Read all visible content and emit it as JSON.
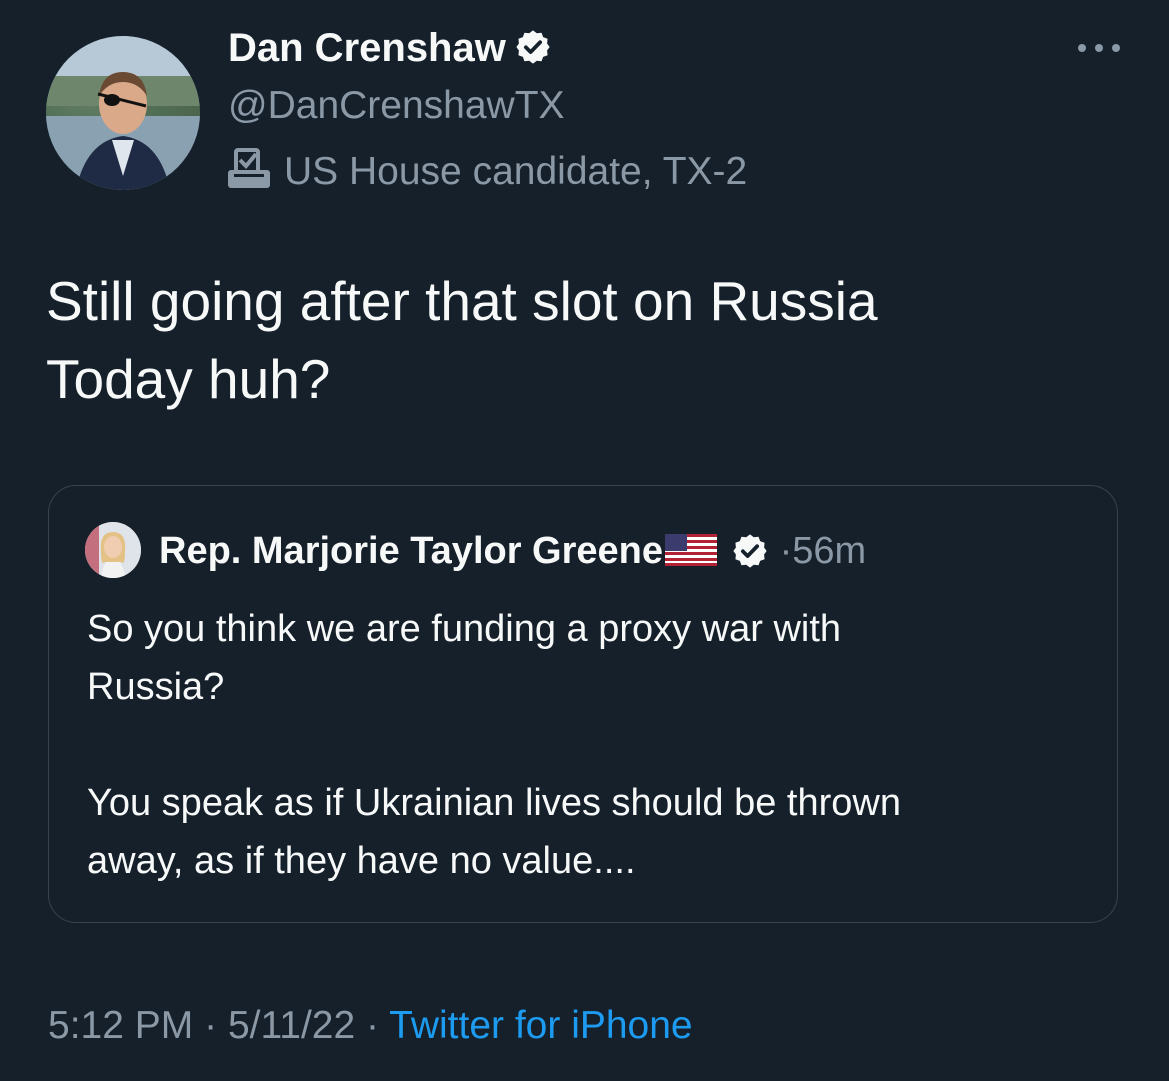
{
  "author": {
    "name": "Dan Crenshaw",
    "handle": "@DanCrenshawTX",
    "label": "US House candidate, TX-2",
    "verified": true
  },
  "tweet": {
    "text_line1": "Still going after that slot on Russia",
    "text_line2": "Today huh?"
  },
  "quoted": {
    "name": "Rep. Marjorie Taylor Greene",
    "verified": true,
    "separator": "·",
    "time": "56m",
    "text_line1": "So you think we are funding a proxy war with",
    "text_line2": "Russia?",
    "text_line3": "You speak as if Ukrainian lives should be thrown",
    "text_line4": "away, as if they have no value...."
  },
  "footer": {
    "time": "5:12 PM",
    "separator1": "·",
    "date": "5/11/22",
    "separator2": "·",
    "source": "Twitter for iPhone"
  },
  "colors": {
    "background": "#15202b",
    "text": "#f7f9f9",
    "secondary": "#8b98a5",
    "link": "#1d9bf0",
    "border": "#38444d"
  }
}
